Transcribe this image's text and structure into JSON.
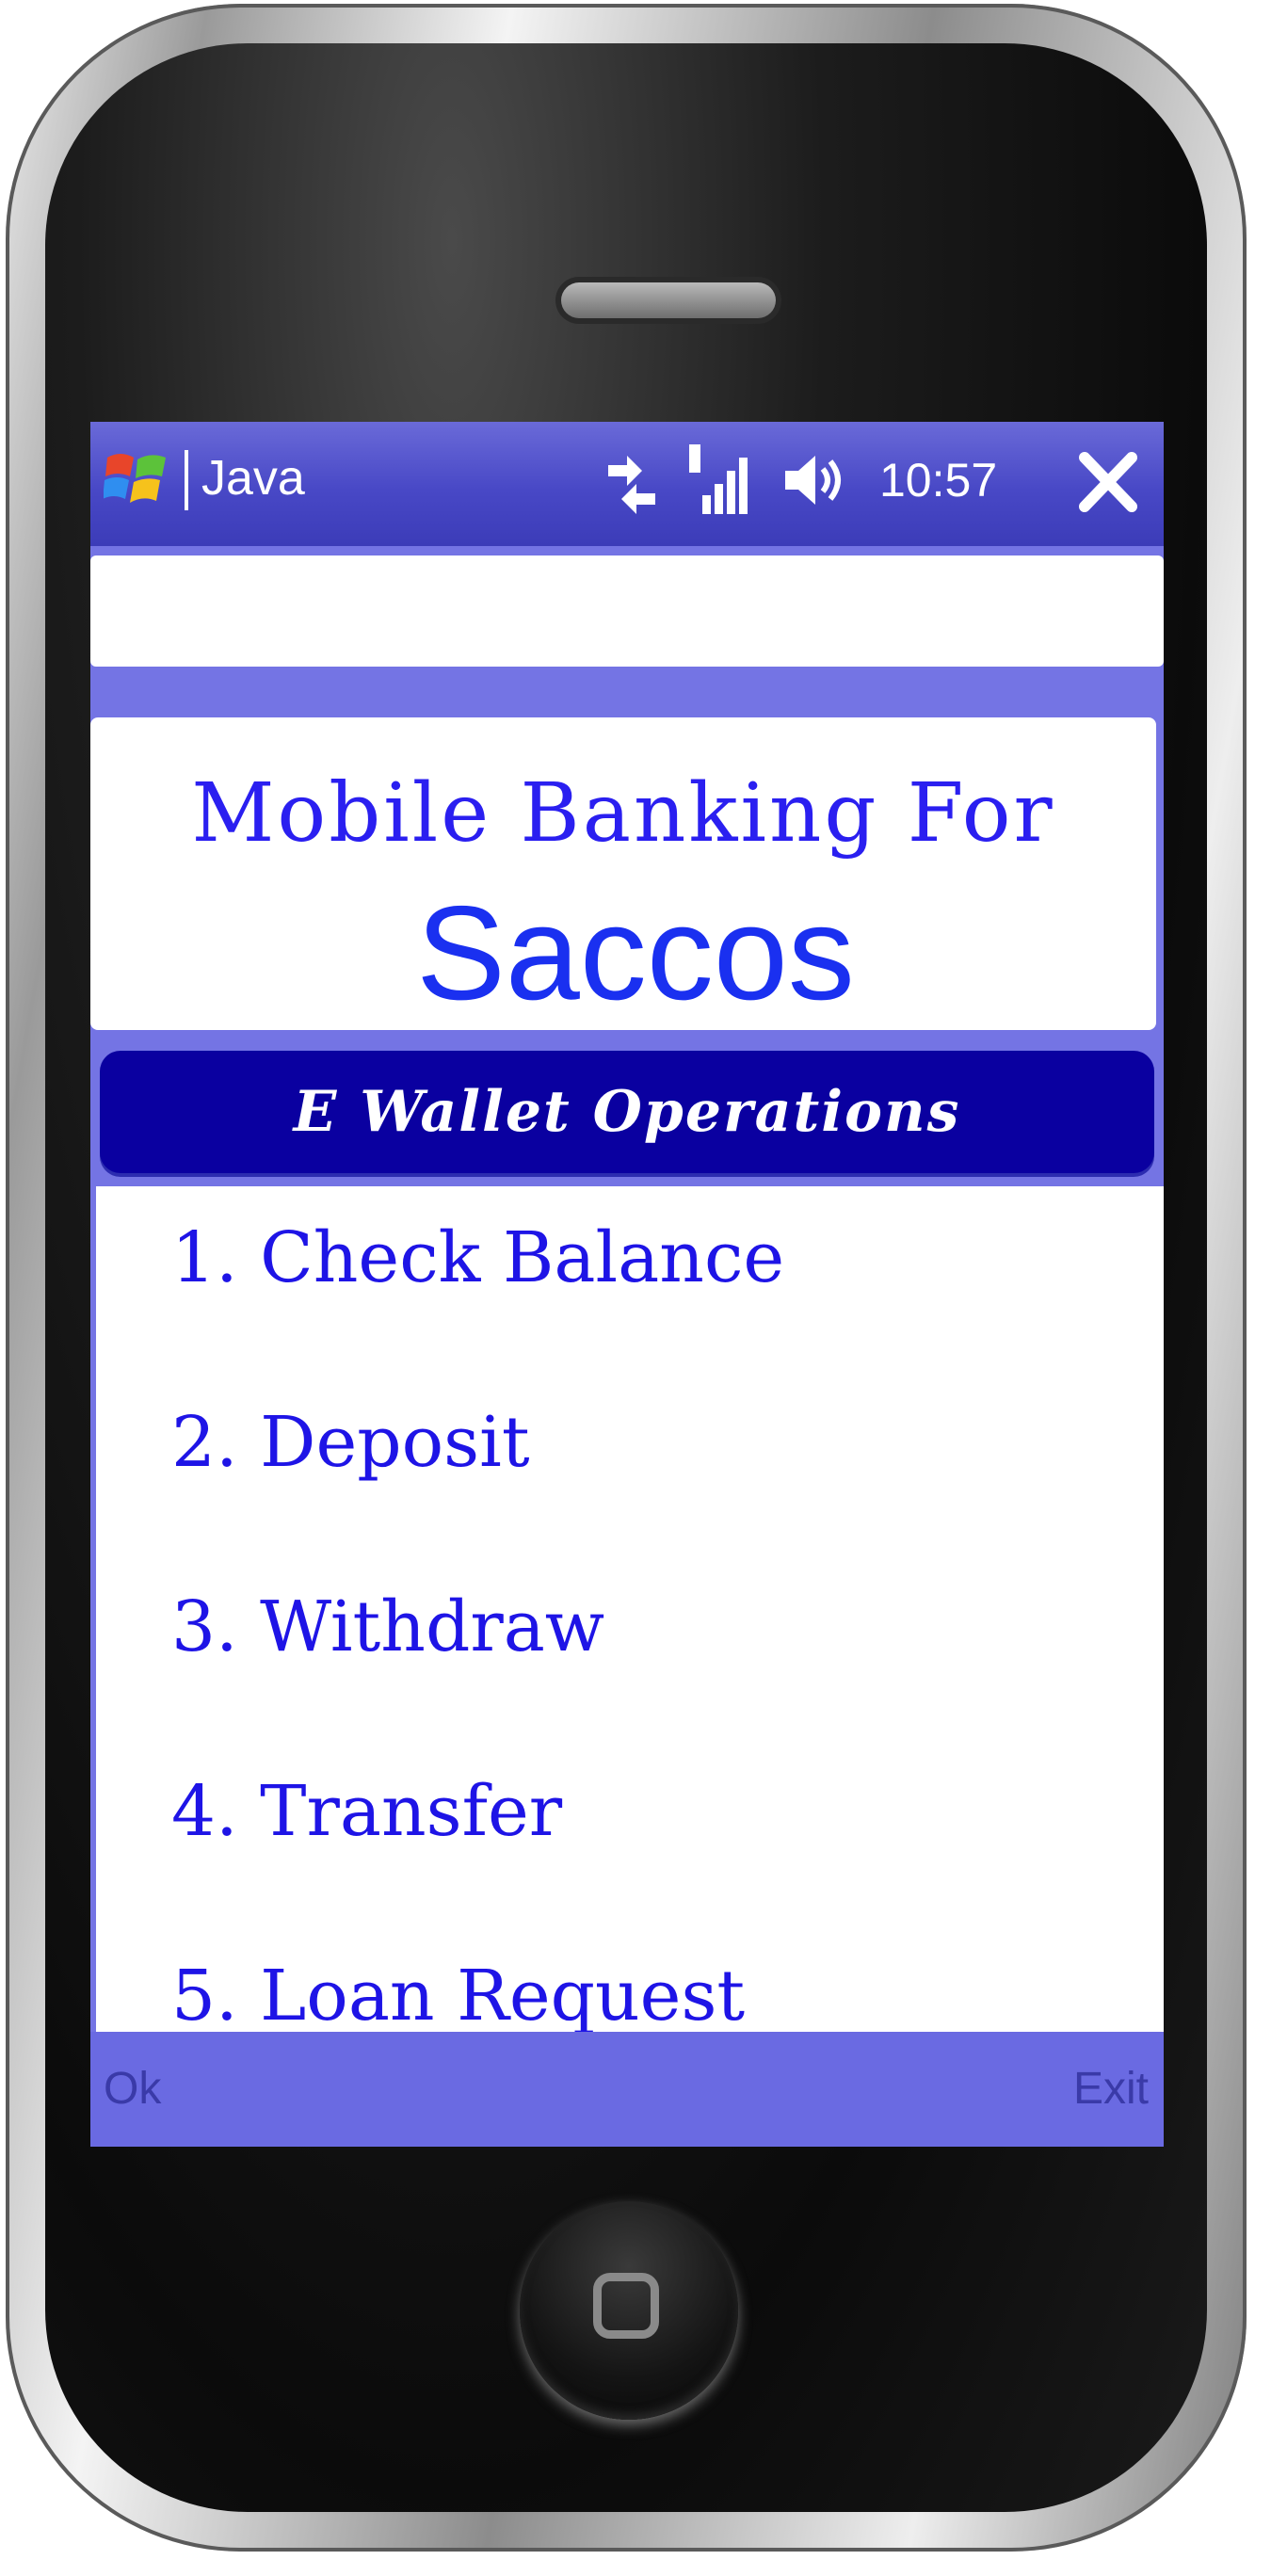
{
  "status_bar": {
    "app_title": "Java",
    "clock": "10:57",
    "icons": [
      "windows-start-icon",
      "connectivity-icon",
      "signal-icon",
      "volume-icon",
      "close-icon"
    ]
  },
  "header": {
    "title_line1": "Mobile Banking For",
    "title_line2": "Saccos"
  },
  "section": {
    "title": "E Wallet Operations"
  },
  "menu": {
    "items": [
      {
        "label": "1. Check Balance"
      },
      {
        "label": "2. Deposit"
      },
      {
        "label": "3. Withdraw"
      },
      {
        "label": "4. Transfer"
      },
      {
        "label": "5. Loan Request"
      }
    ]
  },
  "softkeys": {
    "left": "Ok",
    "right": "Exit"
  },
  "colors": {
    "title_blue": "#2a1ff0",
    "header_navy": "#0a00a0",
    "screen_bg": "#7474e4",
    "menu_text": "#1e14e6"
  }
}
